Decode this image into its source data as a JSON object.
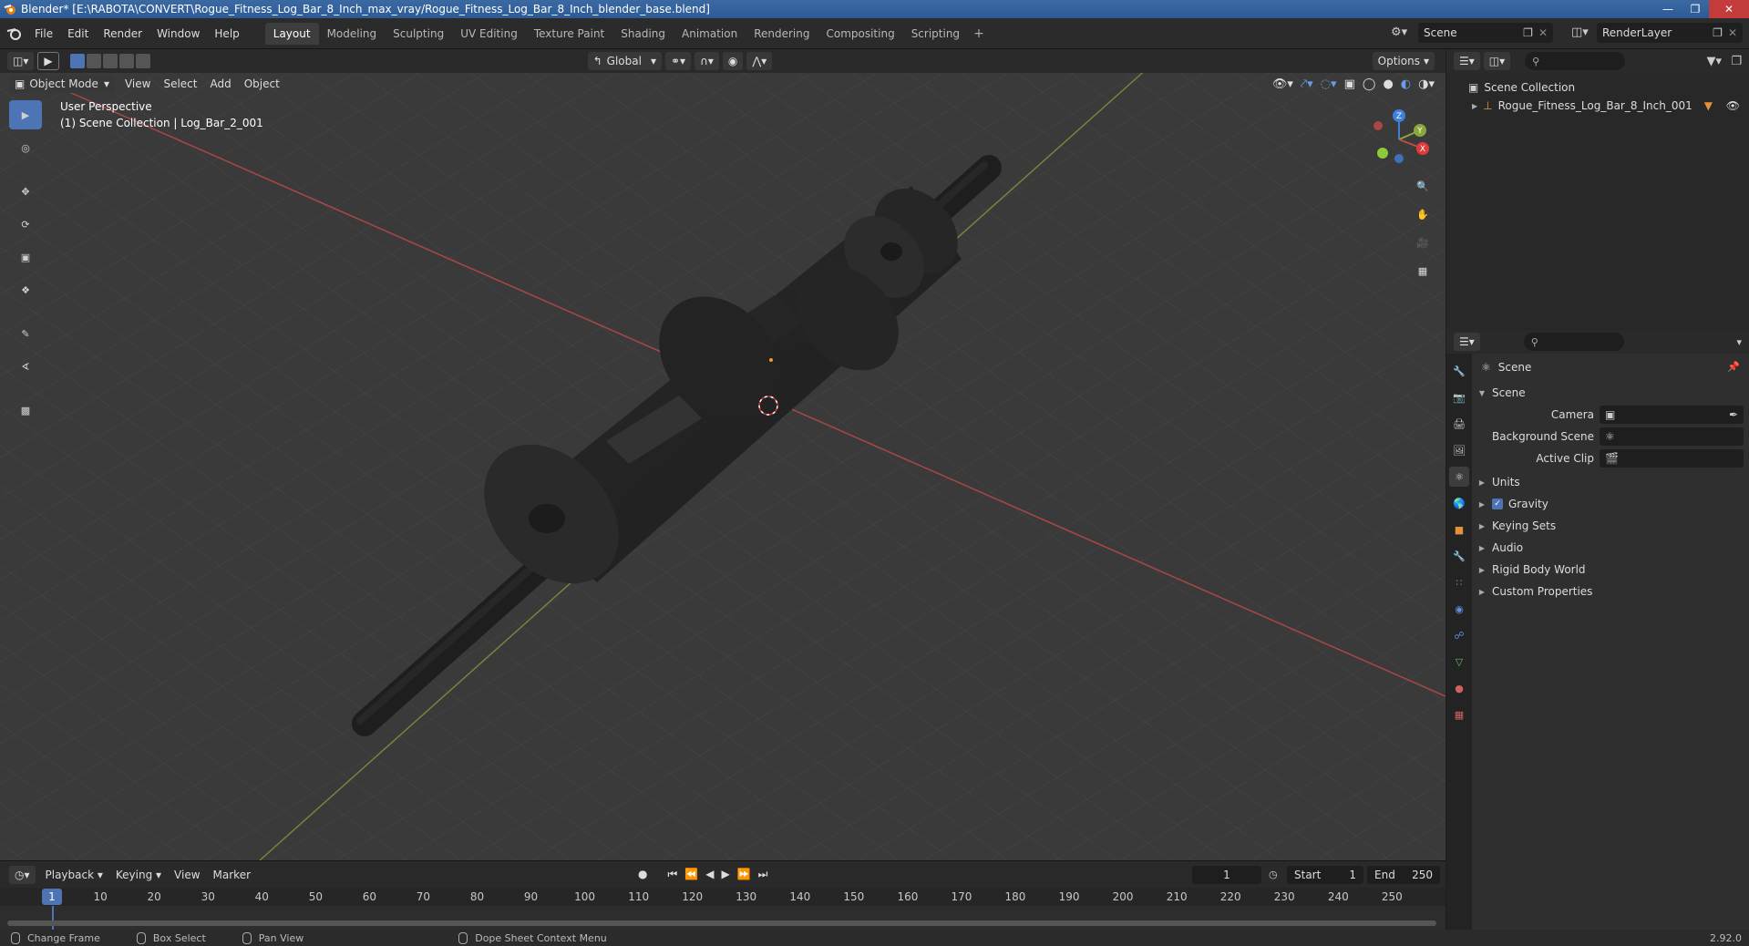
{
  "window": {
    "title": "Blender* [E:\\RABOTA\\CONVERT\\Rogue_Fitness_Log_Bar_8_Inch_max_vray/Rogue_Fitness_Log_Bar_8_Inch_blender_base.blend]"
  },
  "menu": [
    "File",
    "Edit",
    "Render",
    "Window",
    "Help"
  ],
  "workspaces": [
    {
      "label": "Layout",
      "active": true
    },
    {
      "label": "Modeling"
    },
    {
      "label": "Sculpting"
    },
    {
      "label": "UV Editing"
    },
    {
      "label": "Texture Paint"
    },
    {
      "label": "Shading"
    },
    {
      "label": "Animation"
    },
    {
      "label": "Rendering"
    },
    {
      "label": "Compositing"
    },
    {
      "label": "Scripting"
    }
  ],
  "scene_name": "Scene",
  "render_layer": "RenderLayer",
  "viewport": {
    "mode": "Object Mode",
    "menus": [
      "View",
      "Select",
      "Add",
      "Object"
    ],
    "orientation": "Global",
    "options_label": "Options",
    "info_line1": "User Perspective",
    "info_line2": "(1) Scene Collection | Log_Bar_2_001",
    "gizmo": {
      "x": "X",
      "y": "Y",
      "z": "Z"
    }
  },
  "outliner": {
    "root": "Scene Collection",
    "items": [
      "Rogue_Fitness_Log_Bar_8_Inch_001"
    ]
  },
  "properties": {
    "context": "Scene",
    "panel_title": "Scene",
    "fields": [
      {
        "label": "Camera"
      },
      {
        "label": "Background Scene"
      },
      {
        "label": "Active Clip"
      }
    ],
    "subpanels": [
      "Units",
      "Gravity",
      "Keying Sets",
      "Audio",
      "Rigid Body World",
      "Custom Properties"
    ],
    "gravity_checked": true
  },
  "timeline": {
    "menus": [
      "Playback",
      "Keying",
      "View",
      "Marker"
    ],
    "current_frame": "1",
    "start_label": "Start",
    "start": "1",
    "end_label": "End",
    "end": "250",
    "ticks": [
      "1",
      "10",
      "20",
      "30",
      "40",
      "50",
      "60",
      "70",
      "80",
      "90",
      "100",
      "110",
      "120",
      "130",
      "140",
      "150",
      "160",
      "170",
      "180",
      "190",
      "200",
      "210",
      "220",
      "230",
      "240",
      "250"
    ]
  },
  "status": {
    "items": [
      "Change Frame",
      "Box Select",
      "Pan View",
      "Dope Sheet Context Menu"
    ],
    "version": "2.92.0"
  },
  "colors": {
    "accent": "#4d74b4",
    "axis_x": "#c54b4b",
    "axis_y": "#8aa83a",
    "axis_z": "#3f7fd8"
  }
}
